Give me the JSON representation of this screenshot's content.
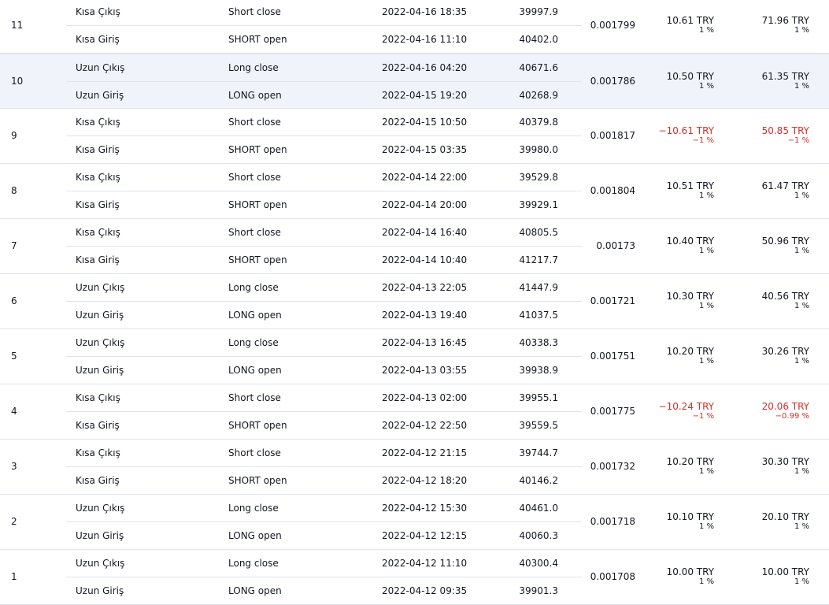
{
  "colors": {
    "negative": "#d1302b",
    "text": "#131722",
    "divider": "#e0e3eb",
    "highlight_row": "#f0f3fa"
  },
  "trades": [
    {
      "num": "11",
      "exit": {
        "type": "Kısa Çıkış",
        "signal": "Short close",
        "date": "2022-04-16 18:35",
        "price": "39997.9"
      },
      "entry": {
        "type": "Kısa Giriş",
        "signal": "SHORT open",
        "date": "2022-04-16 11:10",
        "price": "40402.0"
      },
      "qty": "0.001799",
      "profit": "10.61 TRY",
      "profit_pct": "1 %",
      "profit_negative": false,
      "cum": "71.96 TRY",
      "cum_pct": "1 %",
      "cum_negative": false,
      "highlight": false
    },
    {
      "num": "10",
      "exit": {
        "type": "Uzun Çıkış",
        "signal": "Long close",
        "date": "2022-04-16 04:20",
        "price": "40671.6"
      },
      "entry": {
        "type": "Uzun Giriş",
        "signal": "LONG open",
        "date": "2022-04-15 19:20",
        "price": "40268.9"
      },
      "qty": "0.001786",
      "profit": "10.50 TRY",
      "profit_pct": "1 %",
      "profit_negative": false,
      "cum": "61.35 TRY",
      "cum_pct": "1 %",
      "cum_negative": false,
      "highlight": true
    },
    {
      "num": "9",
      "exit": {
        "type": "Kısa Çıkış",
        "signal": "Short close",
        "date": "2022-04-15 10:50",
        "price": "40379.8"
      },
      "entry": {
        "type": "Kısa Giriş",
        "signal": "SHORT open",
        "date": "2022-04-15 03:35",
        "price": "39980.0"
      },
      "qty": "0.001817",
      "profit": "−10.61 TRY",
      "profit_pct": "−1 %",
      "profit_negative": true,
      "cum": "50.85 TRY",
      "cum_pct": "−1 %",
      "cum_negative": true,
      "highlight": false
    },
    {
      "num": "8",
      "exit": {
        "type": "Kısa Çıkış",
        "signal": "Short close",
        "date": "2022-04-14 22:00",
        "price": "39529.8"
      },
      "entry": {
        "type": "Kısa Giriş",
        "signal": "SHORT open",
        "date": "2022-04-14 20:00",
        "price": "39929.1"
      },
      "qty": "0.001804",
      "profit": "10.51 TRY",
      "profit_pct": "1 %",
      "profit_negative": false,
      "cum": "61.47 TRY",
      "cum_pct": "1 %",
      "cum_negative": false,
      "highlight": false
    },
    {
      "num": "7",
      "exit": {
        "type": "Kısa Çıkış",
        "signal": "Short close",
        "date": "2022-04-14 16:40",
        "price": "40805.5"
      },
      "entry": {
        "type": "Kısa Giriş",
        "signal": "SHORT open",
        "date": "2022-04-14 10:40",
        "price": "41217.7"
      },
      "qty": "0.00173",
      "profit": "10.40 TRY",
      "profit_pct": "1 %",
      "profit_negative": false,
      "cum": "50.96 TRY",
      "cum_pct": "1 %",
      "cum_negative": false,
      "highlight": false
    },
    {
      "num": "6",
      "exit": {
        "type": "Uzun Çıkış",
        "signal": "Long close",
        "date": "2022-04-13 22:05",
        "price": "41447.9"
      },
      "entry": {
        "type": "Uzun Giriş",
        "signal": "LONG open",
        "date": "2022-04-13 19:40",
        "price": "41037.5"
      },
      "qty": "0.001721",
      "profit": "10.30 TRY",
      "profit_pct": "1 %",
      "profit_negative": false,
      "cum": "40.56 TRY",
      "cum_pct": "1 %",
      "cum_negative": false,
      "highlight": false
    },
    {
      "num": "5",
      "exit": {
        "type": "Uzun Çıkış",
        "signal": "Long close",
        "date": "2022-04-13 16:45",
        "price": "40338.3"
      },
      "entry": {
        "type": "Uzun Giriş",
        "signal": "LONG open",
        "date": "2022-04-13 03:55",
        "price": "39938.9"
      },
      "qty": "0.001751",
      "profit": "10.20 TRY",
      "profit_pct": "1 %",
      "profit_negative": false,
      "cum": "30.26 TRY",
      "cum_pct": "1 %",
      "cum_negative": false,
      "highlight": false
    },
    {
      "num": "4",
      "exit": {
        "type": "Kısa Çıkış",
        "signal": "Short close",
        "date": "2022-04-13 02:00",
        "price": "39955.1"
      },
      "entry": {
        "type": "Kısa Giriş",
        "signal": "SHORT open",
        "date": "2022-04-12 22:50",
        "price": "39559.5"
      },
      "qty": "0.001775",
      "profit": "−10.24 TRY",
      "profit_pct": "−1 %",
      "profit_negative": true,
      "cum": "20.06 TRY",
      "cum_pct": "−0.99 %",
      "cum_negative": true,
      "highlight": false
    },
    {
      "num": "3",
      "exit": {
        "type": "Kısa Çıkış",
        "signal": "Short close",
        "date": "2022-04-12 21:15",
        "price": "39744.7"
      },
      "entry": {
        "type": "Kısa Giriş",
        "signal": "SHORT open",
        "date": "2022-04-12 18:20",
        "price": "40146.2"
      },
      "qty": "0.001732",
      "profit": "10.20 TRY",
      "profit_pct": "1 %",
      "profit_negative": false,
      "cum": "30.30 TRY",
      "cum_pct": "1 %",
      "cum_negative": false,
      "highlight": false
    },
    {
      "num": "2",
      "exit": {
        "type": "Uzun Çıkış",
        "signal": "Long close",
        "date": "2022-04-12 15:30",
        "price": "40461.0"
      },
      "entry": {
        "type": "Uzun Giriş",
        "signal": "LONG open",
        "date": "2022-04-12 12:15",
        "price": "40060.3"
      },
      "qty": "0.001718",
      "profit": "10.10 TRY",
      "profit_pct": "1 %",
      "profit_negative": false,
      "cum": "20.10 TRY",
      "cum_pct": "1 %",
      "cum_negative": false,
      "highlight": false
    },
    {
      "num": "1",
      "exit": {
        "type": "Uzun Çıkış",
        "signal": "Long close",
        "date": "2022-04-12 11:10",
        "price": "40300.4"
      },
      "entry": {
        "type": "Uzun Giriş",
        "signal": "LONG open",
        "date": "2022-04-12 09:35",
        "price": "39901.3"
      },
      "qty": "0.001708",
      "profit": "10.00 TRY",
      "profit_pct": "1 %",
      "profit_negative": false,
      "cum": "10.00 TRY",
      "cum_pct": "1 %",
      "cum_negative": false,
      "highlight": false
    }
  ]
}
